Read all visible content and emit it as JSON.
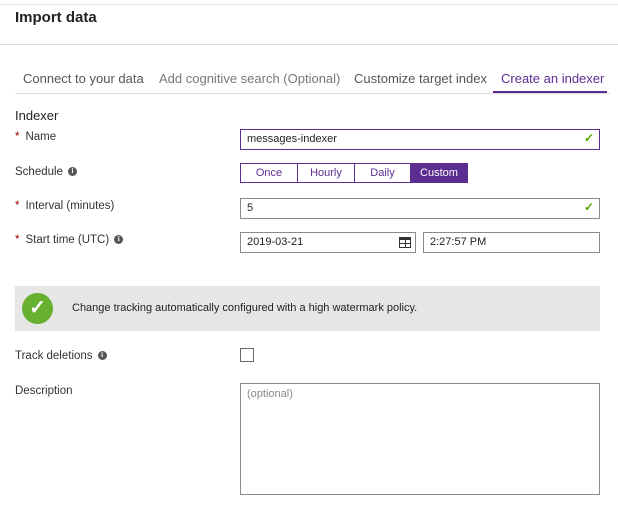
{
  "header": {
    "title": "Import data"
  },
  "tabs": [
    {
      "label": "Connect to your data",
      "state": "done"
    },
    {
      "label": "Add cognitive search (Optional)",
      "state": "disabled"
    },
    {
      "label": "Customize target index",
      "state": "done"
    },
    {
      "label": "Create an indexer",
      "state": "active"
    }
  ],
  "section": {
    "title": "Indexer"
  },
  "form": {
    "name": {
      "label": "Name",
      "required": "*",
      "value": "messages-indexer",
      "valid": true
    },
    "schedule": {
      "label": "Schedule",
      "options": [
        "Once",
        "Hourly",
        "Daily",
        "Custom"
      ],
      "selected": "Custom"
    },
    "interval": {
      "label": "Interval (minutes)",
      "required": "*",
      "value": "5",
      "valid": true
    },
    "start_time": {
      "label": "Start time (UTC)",
      "required": "*",
      "date": "2019-03-21",
      "time": "2:27:57 PM"
    },
    "track_deletions": {
      "label": "Track deletions",
      "checked": false
    },
    "description": {
      "label": "Description",
      "placeholder": "(optional)"
    }
  },
  "banner": {
    "text": "Change tracking automatically configured with a high watermark policy."
  },
  "icons": {
    "info": "info-icon",
    "check": "checkmark-icon",
    "calendar": "calendar-icon",
    "success": "success-checkmark-icon"
  },
  "colors": {
    "accent": "#5c2d91",
    "success": "#68b030",
    "valid_check": "#57a300",
    "required": "#a80000"
  }
}
